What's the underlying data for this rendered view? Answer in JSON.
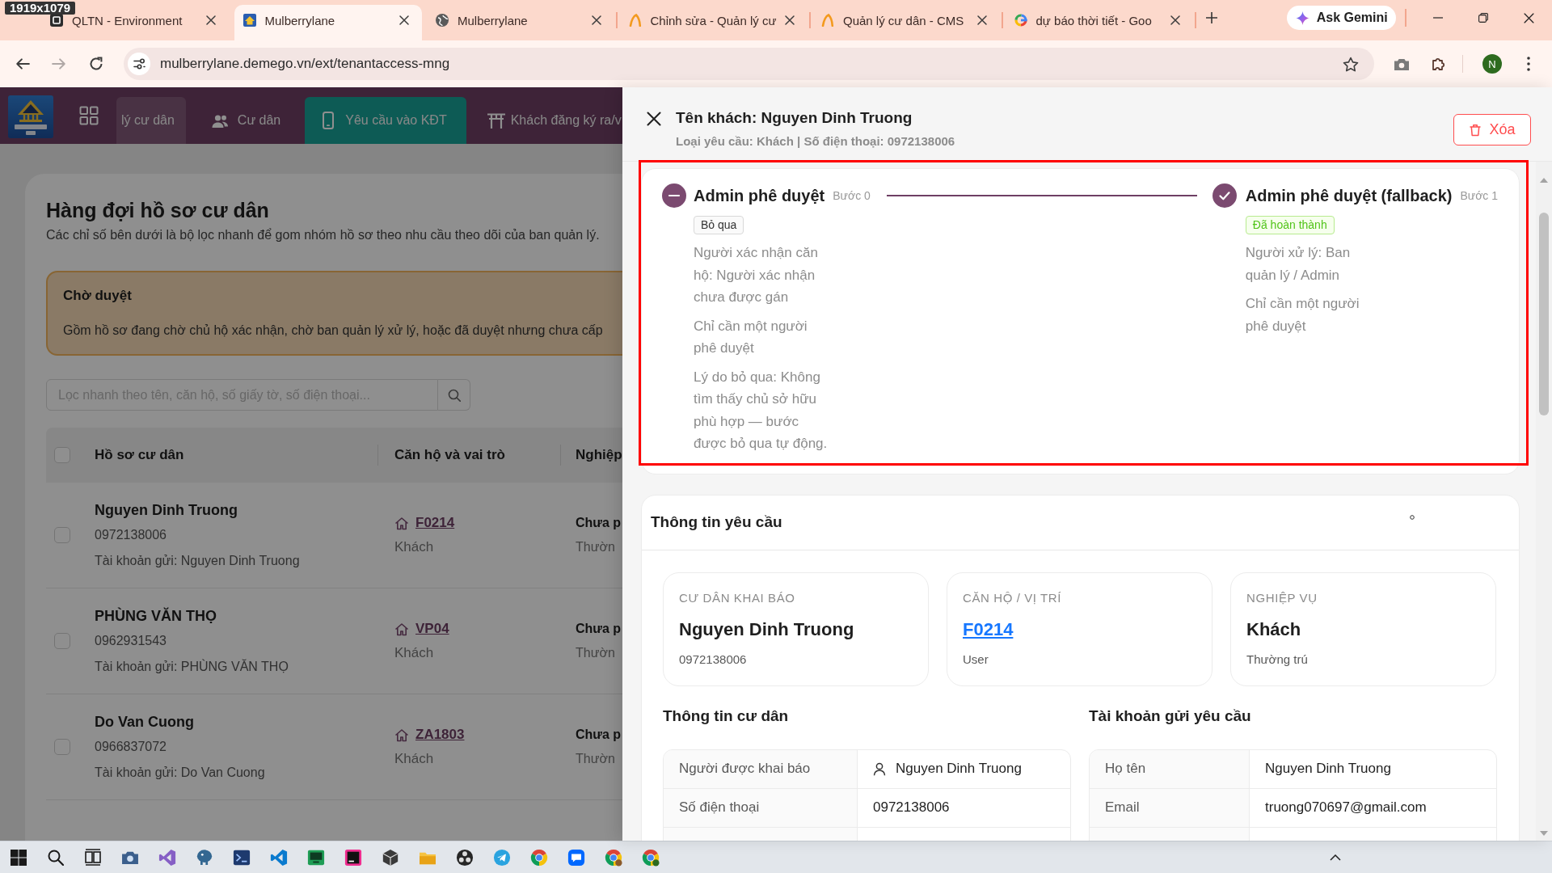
{
  "capture_badge": "1919x1079",
  "browser": {
    "tabs": [
      {
        "title": "QLTN - Environment",
        "kind": "app",
        "selected": false
      },
      {
        "title": "Mulberrylane",
        "kind": "logo",
        "selected": true
      },
      {
        "title": "Mulberrylane",
        "kind": "globe",
        "selected": false
      },
      {
        "title": "Chỉnh sửa - Quản lý cư",
        "kind": "flame",
        "selected": false
      },
      {
        "title": "Quản lý cư dân - CMS",
        "kind": "flame",
        "selected": false
      },
      {
        "title": "dự báo thời tiết - Goo",
        "kind": "google",
        "selected": false
      }
    ],
    "gemini_button": "Ask Gemini",
    "history": {
      "back_disabled": false,
      "forward_disabled": true
    },
    "address": "mulberrylane.demego.vn/ext/tenantaccess-mng",
    "bookmarked": false,
    "profile_initial": "N"
  },
  "nav": {
    "items": [
      {
        "label": "lý cư dân",
        "kind": "plain",
        "hovered": true,
        "selected": false
      },
      {
        "label": "Cư dân",
        "kind": "users",
        "hovered": false,
        "selected": false
      },
      {
        "label": "Yêu cầu vào KĐT",
        "kind": "phone",
        "hovered": false,
        "selected": true
      },
      {
        "label": "Khách đăng ký ra/v",
        "kind": "gate",
        "hovered": false,
        "selected": false
      }
    ]
  },
  "queue": {
    "title": "Hàng đợi hồ sơ cư dân",
    "description": "Các chỉ số bên dưới là bộ lọc nhanh để gom nhóm hồ sơ theo nhu cầu theo dõi của ban quản lý.",
    "filter_card": {
      "title": "Chờ duyệt",
      "text": "Gồm hồ sơ đang chờ chủ hộ xác nhận, chờ ban quản lý xử lý, hoặc đã duyệt nhưng chưa cấp"
    },
    "search": {
      "placeholder": "Lọc nhanh theo tên, căn hộ, số giấy tờ, số điện thoại..."
    },
    "table": {
      "select_all": {
        "checked": false
      },
      "columns": [
        "Hồ sơ cư dân",
        "Căn hộ và vai trò",
        "Nghiệp"
      ],
      "rows": [
        {
          "checked": false,
          "name": "Nguyen Dinh Truong",
          "phone": "0972138006",
          "account": "Tài khoản gửi: Nguyen Dinh Truong",
          "unit": "F0214",
          "role": "Khách",
          "column_3_line_1": "Chưa p",
          "column_3_line_2": "Thườn"
        },
        {
          "checked": false,
          "name": "PHÙNG VĂN THỌ",
          "phone": "0962931543",
          "account": "Tài khoản gửi: PHÙNG VĂN THỌ",
          "unit": "VP04",
          "role": "Khách",
          "column_3_line_1": "Chưa p",
          "column_3_line_2": "Thườn"
        },
        {
          "checked": false,
          "name": "Do Van Cuong",
          "phone": "0966837072",
          "account": "Tài khoản gửi: Do Van Cuong",
          "unit": "ZA1803",
          "role": "Khách",
          "column_3_line_1": "Chưa p",
          "column_3_line_2": "Thườn"
        }
      ]
    }
  },
  "drawer": {
    "title": "Tên khách: Nguyen Dinh Truong",
    "subtitle": "Loại yêu cầu: Khách | Số điện thoại: 0972138006",
    "delete_button": "Xóa",
    "steps": [
      {
        "title": "Admin phê duyệt",
        "step": "Bước 0",
        "kind": "skipped",
        "tag": "Bỏ qua",
        "details": [
          "Người xác nhận căn hộ: Người xác nhận chưa được gán",
          "Chỉ cần một người phê duyệt",
          "Lý do bỏ qua: Không tìm thấy chủ sở hữu phù hợp — bước được bỏ qua tự động."
        ]
      },
      {
        "title": "Admin phê duyệt (fallback)",
        "step": "Bước 1",
        "kind": "finished",
        "tag": "Đã hoàn thành",
        "details": [
          "Người xử lý: Ban quản lý / Admin",
          "Chỉ cần một người phê duyệt"
        ]
      }
    ],
    "request_info": {
      "title": "Thông tin yêu cầu",
      "summary": [
        {
          "label": "CƯ DÂN KHAI BÁO",
          "value": "Nguyen Dinh Truong",
          "kind": "text",
          "note": "0972138006"
        },
        {
          "label": "CĂN HỘ / VỊ TRÍ",
          "value": "F0214",
          "kind": "link",
          "note": "User"
        },
        {
          "label": "NGHIỆP VỤ",
          "value": "Khách",
          "kind": "text",
          "note": "Thường trú"
        }
      ],
      "sections": [
        {
          "title": "Thông tin cư dân",
          "rows": [
            {
              "label": "Người được khai báo",
              "value": "Nguyen Dinh Truong",
              "kind": "person"
            },
            {
              "label": "Số điện thoại",
              "value": "0972138006",
              "kind": "text"
            }
          ]
        },
        {
          "title": "Tài khoản gửi yêu cầu",
          "rows": [
            {
              "label": "Họ tên",
              "value": "Nguyen Dinh Truong",
              "kind": "text"
            },
            {
              "label": "Email",
              "value": "truong070697@gmail.com",
              "kind": "text"
            }
          ]
        }
      ]
    }
  }
}
